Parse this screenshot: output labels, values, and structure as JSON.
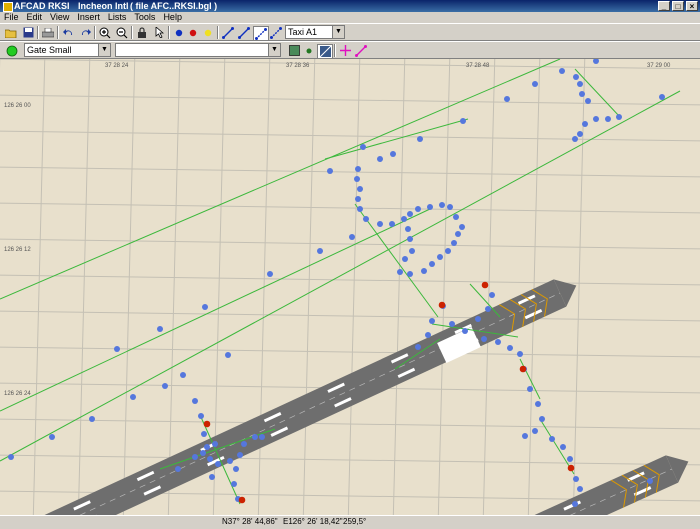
{
  "window": {
    "app": "AFCAD",
    "airport_code": "RKSI",
    "airport_name": "Incheon Intl",
    "file": "( file AFC..RKSI.bgl )"
  },
  "menu": [
    "File",
    "Edit",
    "View",
    "Insert",
    "Lists",
    "Tools",
    "Help"
  ],
  "toolbar": {
    "link_type": "Taxi A1",
    "parking_type": "Gate Small",
    "second_select": ""
  },
  "map": {
    "lon_labels": [
      "37 28 24",
      "37 28 36",
      "37 28 48",
      "37 29 00"
    ],
    "lat_labels": [
      "126 26 00",
      "126 26 12",
      "126 26 24"
    ],
    "colors": {
      "background": "#e8e0cc",
      "grid": "#c4c0b4",
      "taxi_node": "#5577dd",
      "taxi_link": "#3cb83c",
      "hold_short": "#cc2200",
      "runway": "#6e6e6e",
      "runway_marking": "#ffffff",
      "runway_edge": "#dd9900"
    }
  },
  "status": {
    "lat": "N37° 28' 44,86\"",
    "lon": "E126° 26' 18,42\"",
    "heading": "259,5°"
  }
}
